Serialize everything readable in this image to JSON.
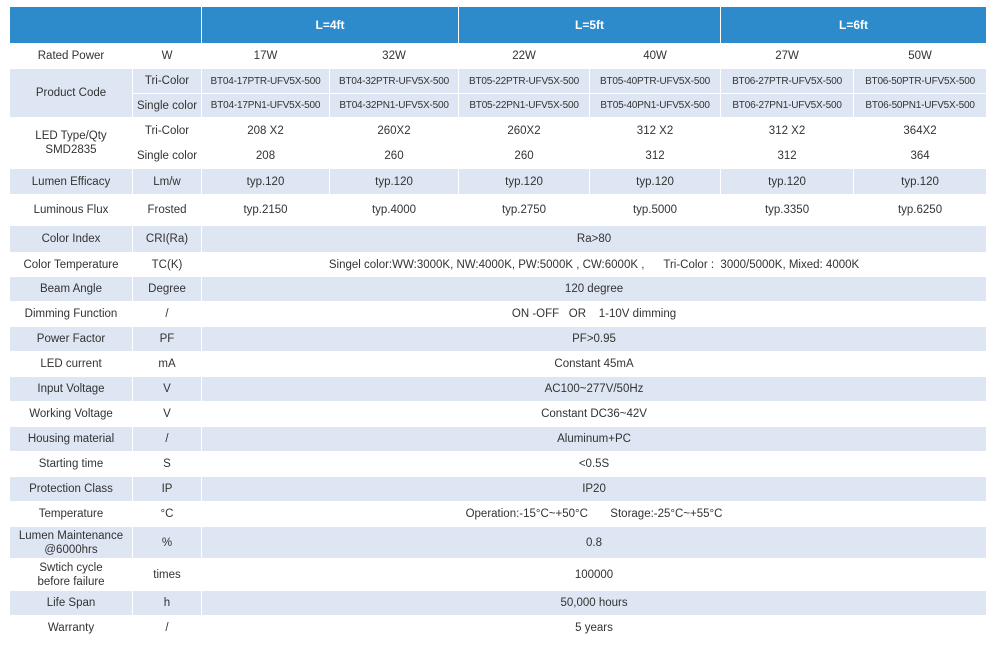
{
  "header": {
    "groups": [
      "L=4ft",
      "L=5ft",
      "L=6ft"
    ]
  },
  "rows": {
    "rated_power": {
      "label": "Rated Power",
      "unit": "W",
      "values": [
        "17W",
        "32W",
        "22W",
        "40W",
        "27W",
        "50W"
      ]
    },
    "product_code": {
      "label": "Product Code",
      "tri": {
        "sub": "Tri-Color",
        "values": [
          "BT04-17PTR-UFV5X-500",
          "BT04-32PTR-UFV5X-500",
          "BT05-22PTR-UFV5X-500",
          "BT05-40PTR-UFV5X-500",
          "BT06-27PTR-UFV5X-500",
          "BT06-50PTR-UFV5X-500"
        ]
      },
      "single": {
        "sub": "Single color",
        "values": [
          "BT04-17PN1-UFV5X-500",
          "BT04-32PN1-UFV5X-500",
          "BT05-22PN1-UFV5X-500",
          "BT05-40PN1-UFV5X-500",
          "BT06-27PN1-UFV5X-500",
          "BT06-50PN1-UFV5X-500"
        ]
      }
    },
    "led_type": {
      "label_line1": "LED Type/Qty",
      "label_line2": "SMD2835",
      "tri": {
        "sub": "Tri-Color",
        "values": [
          "208 X2",
          "260X2",
          "260X2",
          "312 X2",
          "312 X2",
          "364X2"
        ]
      },
      "single": {
        "sub": "Single color",
        "values": [
          "208",
          "260",
          "260",
          "312",
          "312",
          "364"
        ]
      }
    },
    "lumen_efficacy": {
      "label": "Lumen Efficacy",
      "unit": "Lm/w",
      "values": [
        "typ.120",
        "typ.120",
        "typ.120",
        "typ.120",
        "typ.120",
        "typ.120"
      ]
    },
    "luminous_flux": {
      "label": "Luminous Flux",
      "unit": "Frosted",
      "values": [
        "typ.2150",
        "typ.4000",
        "typ.2750",
        "typ.5000",
        "typ.3350",
        "typ.6250"
      ]
    },
    "color_index": {
      "label": "Color Index",
      "unit": "CRI(Ra)",
      "value": "Ra>80"
    },
    "color_temperature": {
      "label": "Color Temperature",
      "unit": "TC(K)",
      "value": "Singel color:WW:3000K, NW:4000K, PW:5000K , CW:6000K ,      Tri-Color :  3000/5000K, Mixed: 4000K"
    },
    "beam_angle": {
      "label": "Beam Angle",
      "unit": "Degree",
      "value": "120 degree"
    },
    "dimming_function": {
      "label": "Dimming Function",
      "unit": "/",
      "value": "ON -OFF   OR    1-10V dimming"
    },
    "power_factor": {
      "label": "Power Factor",
      "unit": "PF",
      "value": "PF>0.95"
    },
    "led_current": {
      "label": "LED current",
      "unit": "mA",
      "value": "Constant 45mA"
    },
    "input_voltage": {
      "label": "Input Voltage",
      "unit": "V",
      "value": "AC100~277V/50Hz"
    },
    "working_voltage": {
      "label": "Working Voltage",
      "unit": "V",
      "value": "Constant DC36~42V"
    },
    "housing_material": {
      "label": "Housing material",
      "unit": "/",
      "value": "Aluminum+PC"
    },
    "starting_time": {
      "label": "Starting time",
      "unit": "S",
      "value": "<0.5S"
    },
    "protection_class": {
      "label": "Protection Class",
      "unit": "IP",
      "value": "IP20"
    },
    "temperature": {
      "label": "Temperature",
      "unit": "°C",
      "value": "Operation:-15°C~+50°C       Storage:-25°C~+55°C"
    },
    "lumen_maintenance": {
      "label_line1": "Lumen Maintenance",
      "label_line2": "@6000hrs",
      "unit": "%",
      "value": "0.8"
    },
    "switch_cycle": {
      "label_line1": "Swtich cycle",
      "label_line2": "before failure",
      "unit": "times",
      "value": "100000"
    },
    "life_span": {
      "label": "Life Span",
      "unit": "h",
      "value": "50,000 hours"
    },
    "warranty": {
      "label": "Warranty",
      "unit": "/",
      "value": "5 years"
    }
  },
  "colors": {
    "header_blue": "#2d8bcc",
    "row_shade": "#dde6f2",
    "text": "#333333"
  }
}
